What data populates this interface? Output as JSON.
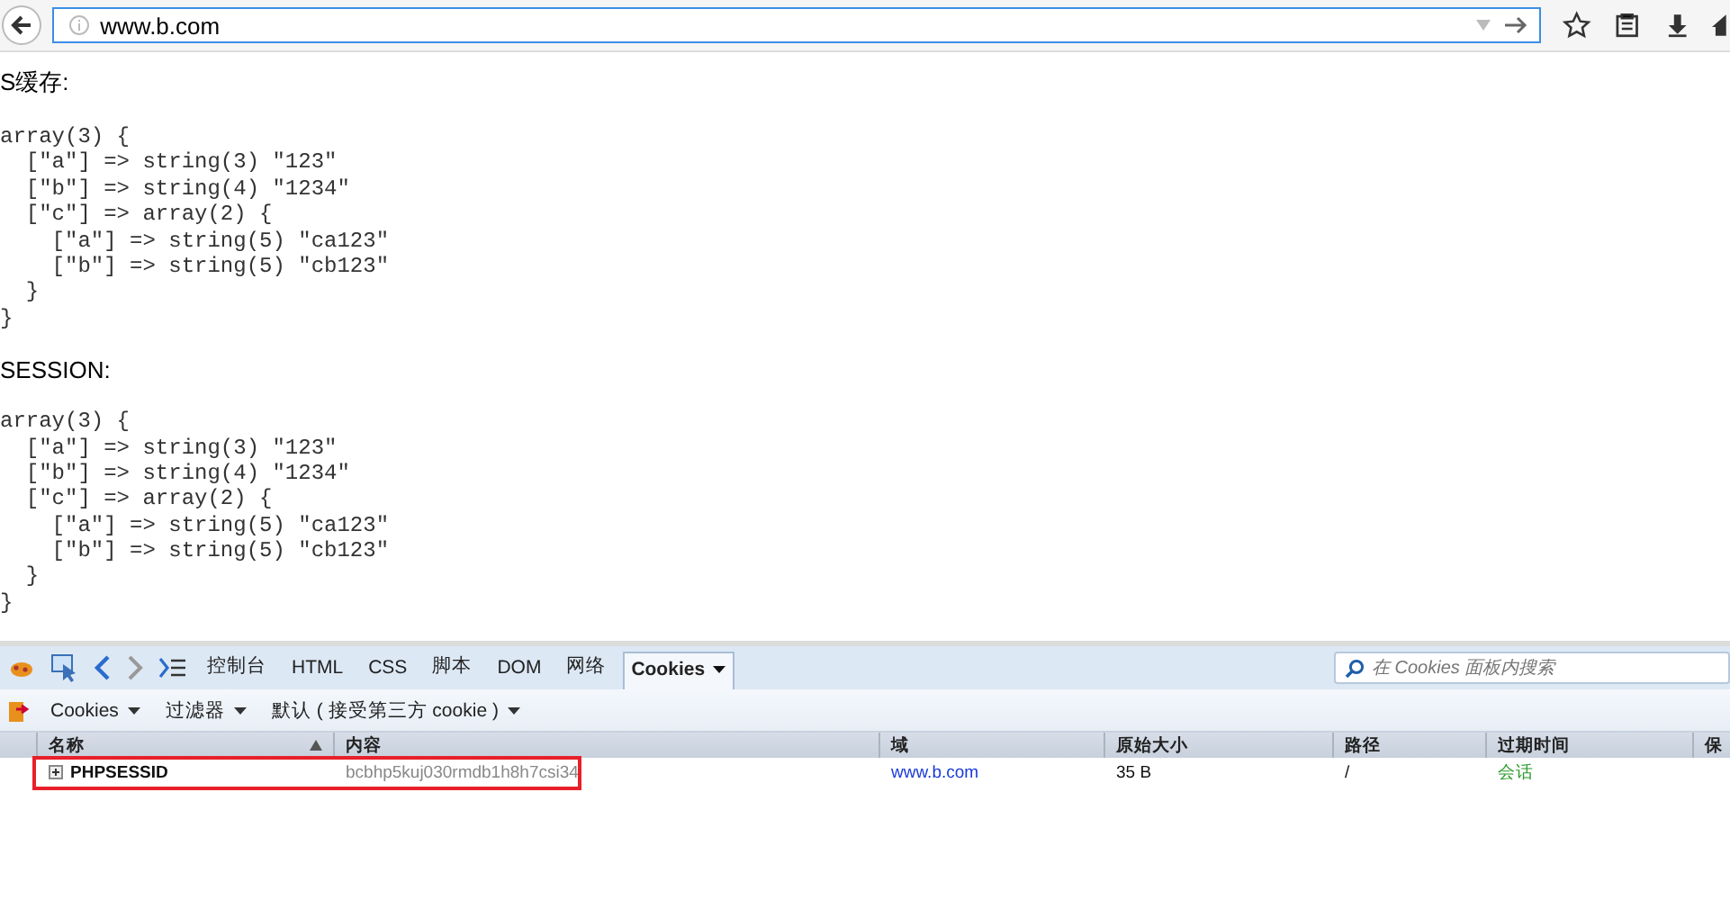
{
  "address_bar": {
    "url": "www.b.com"
  },
  "page": {
    "sections": [
      {
        "heading": "S缓存:",
        "dump": [
          "array(3) {",
          "  [\"a\"] => string(3) \"123\"",
          "  [\"b\"] => string(4) \"1234\"",
          "  [\"c\"] => array(2) {",
          "    [\"a\"] => string(5) \"ca123\"",
          "    [\"b\"] => string(5) \"cb123\"",
          "  }",
          "}"
        ]
      },
      {
        "heading": "SESSION:",
        "dump": [
          "array(3) {",
          "  [\"a\"] => string(3) \"123\"",
          "  [\"b\"] => string(4) \"1234\"",
          "  [\"c\"] => array(2) {",
          "    [\"a\"] => string(5) \"ca123\"",
          "    [\"b\"] => string(5) \"cb123\"",
          "  }",
          "}"
        ]
      }
    ]
  },
  "devtools": {
    "tabs": [
      {
        "label": "控制台",
        "selected": false
      },
      {
        "label": "HTML",
        "selected": false
      },
      {
        "label": "CSS",
        "selected": false
      },
      {
        "label": "脚本",
        "selected": false
      },
      {
        "label": "DOM",
        "selected": false
      },
      {
        "label": "网络",
        "selected": false
      },
      {
        "label": "Cookies",
        "selected": true
      }
    ],
    "search": {
      "placeholder": "在 Cookies 面板内搜索"
    },
    "toolbar": [
      "Cookies",
      "过滤器",
      "默认 ( 接受第三方 cookie )"
    ],
    "table": {
      "columns": [
        "名称",
        "内容",
        "域",
        "原始大小",
        "路径",
        "过期时间",
        "保"
      ],
      "rows": [
        {
          "name": "PHPSESSID",
          "value": "bcbhp5kuj030rmdb1h8h7csi34",
          "domain": "www.b.com",
          "size": "35 B",
          "path": "/",
          "expires": "会话",
          "highlighted": true
        }
      ]
    }
  }
}
